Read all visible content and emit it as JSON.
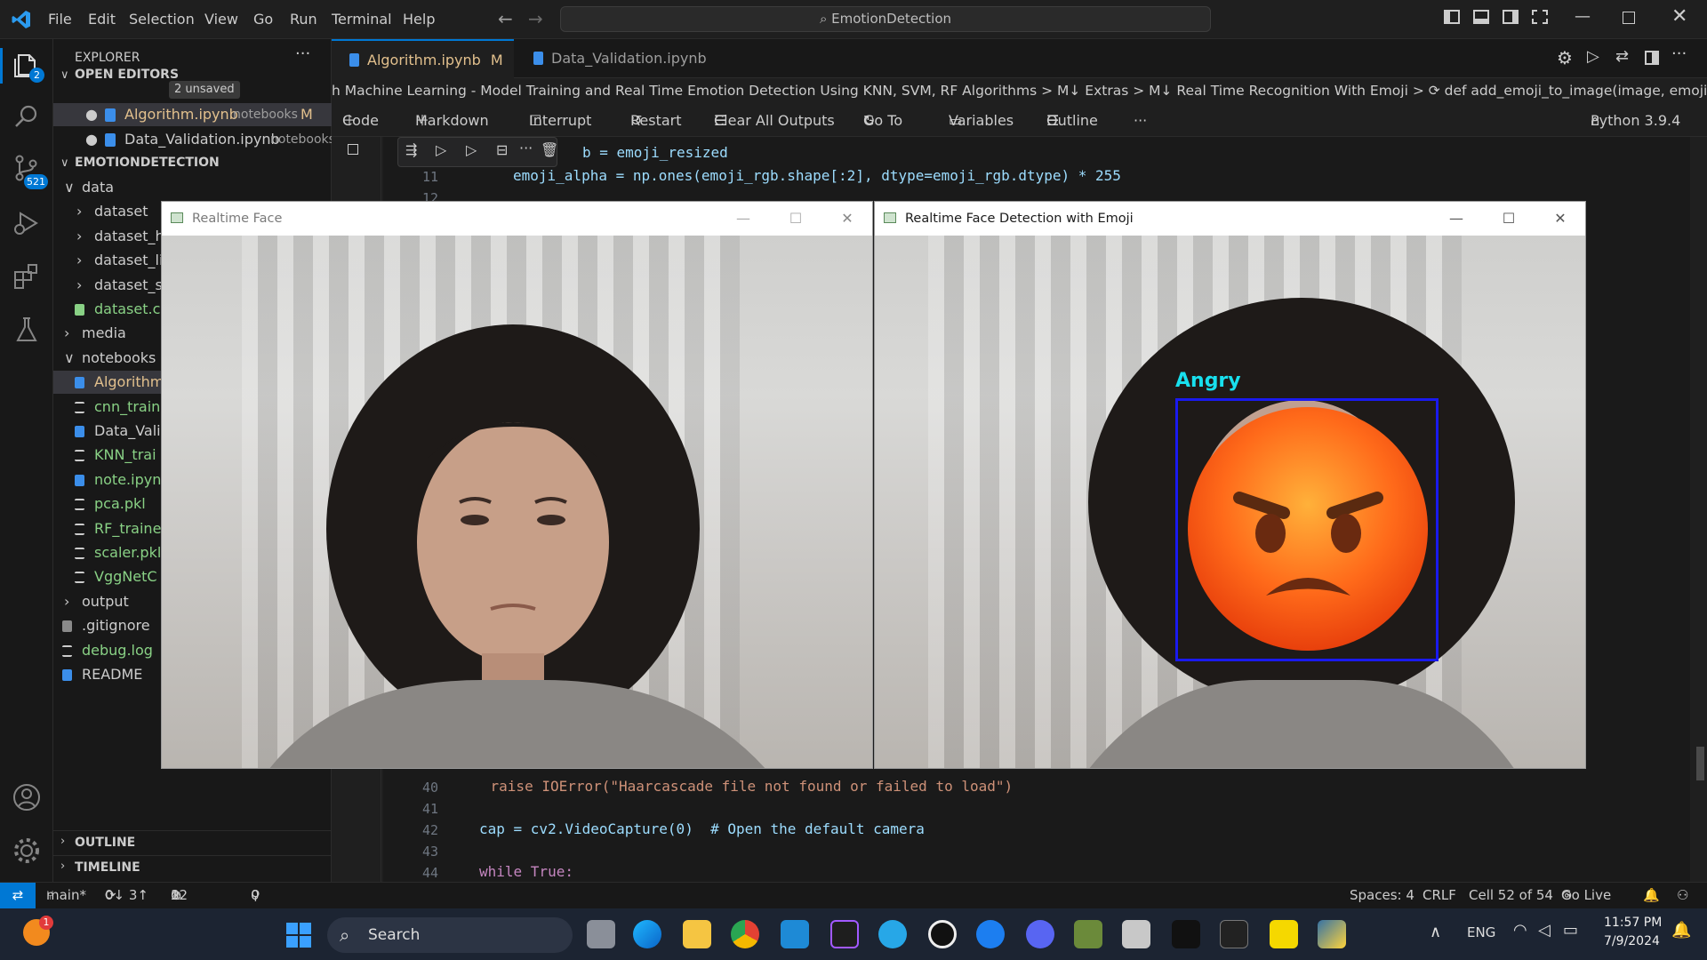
{
  "titlebar": {
    "menu": [
      "File",
      "Edit",
      "Selection",
      "View",
      "Go",
      "Run",
      "Terminal",
      "Help"
    ],
    "search": "EmotionDetection"
  },
  "activity": {
    "explorer_badge": "2",
    "scm_badge": "521"
  },
  "sidebar": {
    "title": "EXPLORER",
    "open_editors": {
      "label": "OPEN EDITORS",
      "badge": "2 unsaved"
    },
    "open_files": [
      {
        "name": "Algorithm.ipynb",
        "path": "notebooks",
        "status": "M"
      },
      {
        "name": "Data_Validation.ipynb",
        "path": "notebooks"
      }
    ],
    "project": "EMOTIONDETECTION",
    "tree": [
      {
        "name": "data",
        "indent": 1,
        "type": "folder-open"
      },
      {
        "name": "dataset",
        "indent": 2,
        "type": "folder"
      },
      {
        "name": "dataset_h",
        "indent": 2,
        "type": "folder"
      },
      {
        "name": "dataset_li",
        "indent": 2,
        "type": "folder"
      },
      {
        "name": "dataset_s",
        "indent": 2,
        "type": "folder"
      },
      {
        "name": "dataset.cs",
        "indent": 2,
        "type": "csv"
      },
      {
        "name": "media",
        "indent": 1,
        "type": "folder"
      },
      {
        "name": "notebooks",
        "indent": 1,
        "type": "folder-open"
      },
      {
        "name": "Algorithm",
        "indent": 2,
        "type": "nb",
        "selected": true
      },
      {
        "name": "cnn_train",
        "indent": 2,
        "type": "txt"
      },
      {
        "name": "Data_Vali",
        "indent": 2,
        "type": "nb"
      },
      {
        "name": "KNN_trai",
        "indent": 2,
        "type": "txt"
      },
      {
        "name": "note.ipyn",
        "indent": 2,
        "type": "nb"
      },
      {
        "name": "pca.pkl",
        "indent": 2,
        "type": "file"
      },
      {
        "name": "RF_traine",
        "indent": 2,
        "type": "txt"
      },
      {
        "name": "scaler.pkl",
        "indent": 2,
        "type": "file"
      },
      {
        "name": "VggNetC",
        "indent": 2,
        "type": "txt"
      },
      {
        "name": "output",
        "indent": 1,
        "type": "folder"
      },
      {
        "name": ".gitignore",
        "indent": 1,
        "type": "git"
      },
      {
        "name": "debug.log",
        "indent": 1,
        "type": "txt"
      },
      {
        "name": "README",
        "indent": 1,
        "type": "info"
      }
    ],
    "outline": "OUTLINE",
    "timeline": "TIMELINE"
  },
  "tabs": [
    {
      "name": "Algorithm.ipynb",
      "status": "M",
      "active": true
    },
    {
      "name": "Data_Validation.ipynb",
      "active": false
    }
  ],
  "breadcrumb": "h Machine Learning - Model Training and Real Time Emotion Detection Using KNN, SVM, RF Algorithms > M↓ Extras > M↓ Real Time Recognition With Emoji > ⟳ def add_emoji_to_image(image, emoji_img, x, y, w, h):",
  "toolbar": {
    "code": "Code",
    "markdown": "Markdown",
    "interrupt": "Interrupt",
    "restart": "Restart",
    "clear": "Clear All Outputs",
    "goto": "Go To",
    "variables": "Variables",
    "outline": "Outline",
    "kernel": "Python 3.9.4"
  },
  "code_top": [
    {
      "ln": "",
      "text": "b = emoji_resized"
    },
    {
      "ln": "11",
      "text": "emoji_alpha = np.ones(emoji_rgb.shape[:2], dtype=emoji_rgb.dtype) * 255"
    },
    {
      "ln": "12",
      "text": ""
    }
  ],
  "code_bottom": [
    {
      "ln": "40",
      "text": "    raise IOError(\"Haarcascade file not found or failed to load\")"
    },
    {
      "ln": "41",
      "text": ""
    },
    {
      "ln": "42",
      "text": "cap = cv2.VideoCapture(0)  # Open the default camera"
    },
    {
      "ln": "43",
      "text": ""
    },
    {
      "ln": "44",
      "text": "while True:"
    }
  ],
  "window1": {
    "title": "Realtime Face"
  },
  "window2": {
    "title": "Realtime Face Detection with Emoji",
    "emotion": "Angry"
  },
  "status": {
    "branch": "main*",
    "sync": "0↓ 3↑",
    "errors": "0",
    "warnings": "12",
    "ports": "0",
    "spaces": "Spaces: 4",
    "eol": "CRLF",
    "cell": "Cell 52 of 54",
    "golive": "Go Live"
  },
  "taskbar": {
    "search": "Search",
    "lang": "ENG",
    "time": "11:57 PM",
    "date": "7/9/2024",
    "notif": "1"
  }
}
